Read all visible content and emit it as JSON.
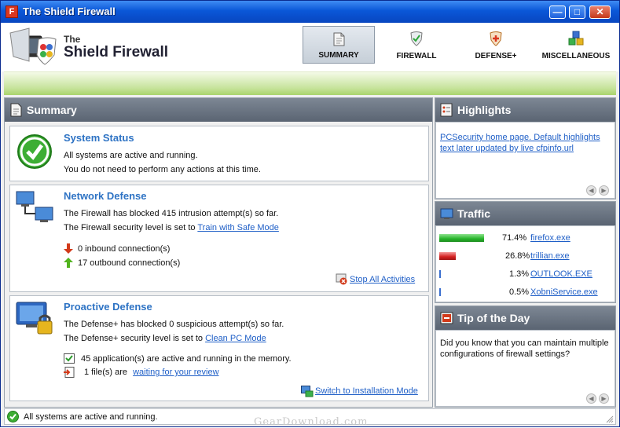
{
  "window": {
    "app_icon": "F",
    "title": "The Shield Firewall",
    "controls": {
      "minimize": "—",
      "maximize": "□",
      "close": "✕"
    }
  },
  "logo": {
    "line1": "The",
    "line2": "Shield Firewall"
  },
  "nav": {
    "tabs": [
      {
        "label": "SUMMARY",
        "icon": "summary-document-icon",
        "active": true
      },
      {
        "label": "FIREWALL",
        "icon": "firewall-shield-icon",
        "active": false
      },
      {
        "label": "DEFENSE+",
        "icon": "defense-plus-shield-icon",
        "active": false
      },
      {
        "label": "MISCELLANEOUS",
        "icon": "cubes-icon",
        "active": false
      }
    ]
  },
  "summary": {
    "title": "Summary",
    "system_status": {
      "title": "System Status",
      "line1": "All systems are active and running.",
      "line2": "You do not need to perform any actions at this time."
    },
    "network_defense": {
      "title": "Network Defense",
      "line1": "The Firewall has blocked 415 intrusion attempt(s) so far.",
      "line2_prefix": "The Firewall security level is set to",
      "line2_link": "Train with Safe Mode",
      "inbound": "0 inbound connection(s)",
      "outbound": "17 outbound connection(s)",
      "stop_link": "Stop All Activities"
    },
    "proactive_defense": {
      "title": "Proactive Defense",
      "line1": "The Defense+ has blocked 0 suspicious attempt(s) so far.",
      "line2_prefix": "The Defense+ security level is set to",
      "line2_link": "Clean PC Mode",
      "apps": "45 application(s) are active and running in the memory.",
      "files_prefix": "1 file(s) are",
      "files_link": "waiting for your review",
      "switch_link": "Switch to Installation Mode"
    }
  },
  "highlights": {
    "title": "Highlights",
    "text": "PCSecurity home page. Default highlights text later updated by live cfpinfo.url",
    "prev": "◀",
    "next": "▶"
  },
  "traffic": {
    "title": "Traffic",
    "rows": [
      {
        "percent": "71.4%",
        "fraction": 0.714,
        "app": "firefox.exe",
        "color": "#27b52b"
      },
      {
        "percent": "26.8%",
        "fraction": 0.268,
        "app": "trillian.exe",
        "color": "#d42020"
      },
      {
        "percent": "1.3%",
        "fraction": 0.013,
        "app": "OUTLOOK.EXE",
        "color": "#3a6fcf"
      },
      {
        "percent": "0.5%",
        "fraction": 0.005,
        "app": "XobniService.exe",
        "color": "#3a6fcf"
      }
    ]
  },
  "tip": {
    "title": "Tip of the Day",
    "text": "Did you know that you can maintain multiple configurations of firewall settings?",
    "prev": "◀",
    "next": "▶"
  },
  "statusbar": {
    "text": "All systems are active and running."
  },
  "watermark": "GearDownload.com"
}
